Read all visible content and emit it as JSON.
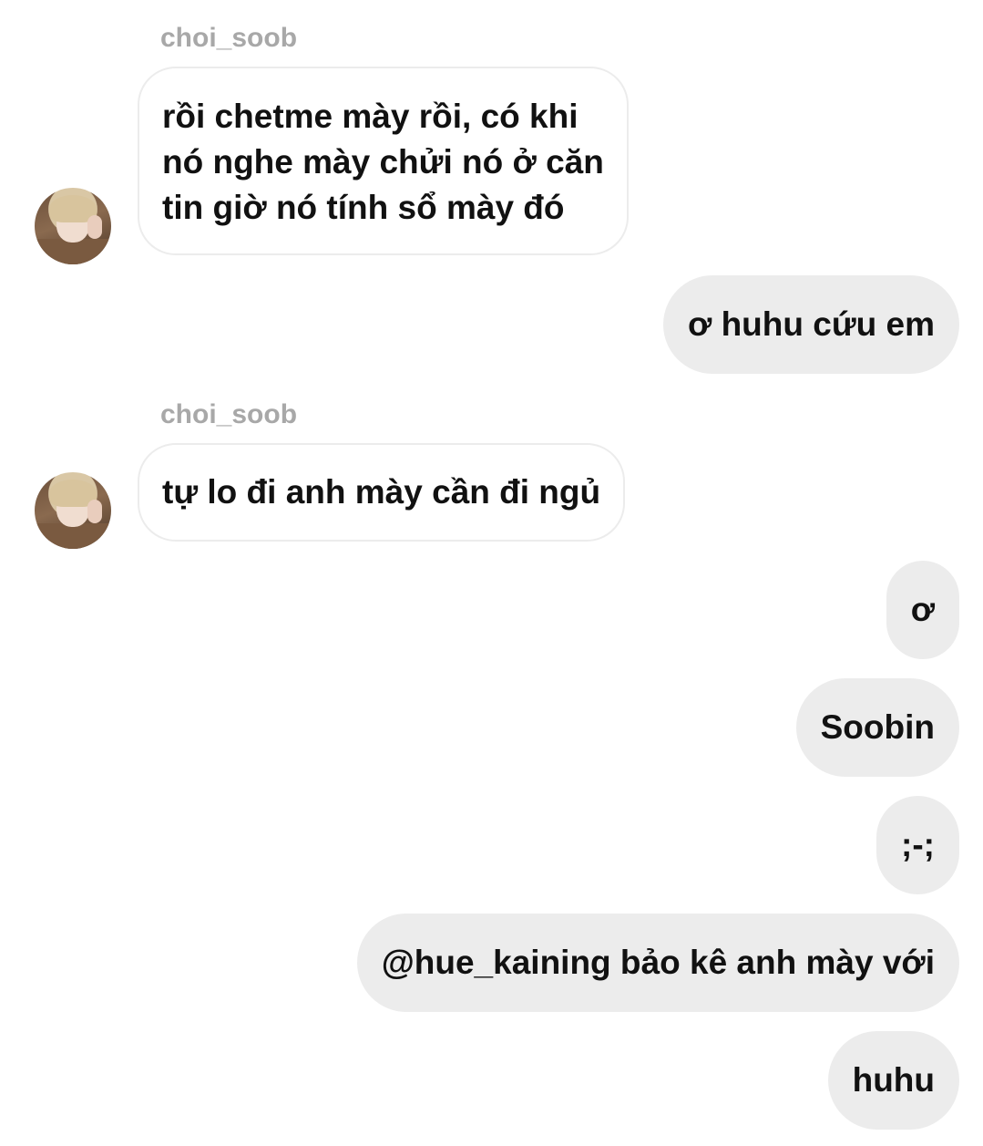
{
  "messages": [
    {
      "direction": "incoming",
      "username": "choi_soob",
      "avatar_icon": "user-avatar-photo",
      "lines": [
        "rồi chetme mày rồi, có khi",
        "nó nghe mày chửi nó ở căn",
        "tin giờ nó tính sổ mày đó"
      ]
    },
    {
      "direction": "outgoing",
      "text": "ơ huhu cứu em"
    },
    {
      "direction": "incoming",
      "username": "choi_soob",
      "avatar_icon": "user-avatar-photo",
      "lines": [
        "tự lo đi anh mày cần đi ngủ"
      ]
    },
    {
      "direction": "outgoing",
      "text": "ơ"
    },
    {
      "direction": "outgoing",
      "text": "Soobin"
    },
    {
      "direction": "outgoing",
      "text": ";-;"
    },
    {
      "direction": "outgoing",
      "text": "@hue_kaining bảo kê anh mày với"
    },
    {
      "direction": "outgoing",
      "text": "huhu"
    }
  ],
  "colors": {
    "background": "#ffffff",
    "incoming_bubble_border": "#ececec",
    "outgoing_bubble": "#ececec",
    "username": "#a8a8a8",
    "text": "#111111"
  }
}
